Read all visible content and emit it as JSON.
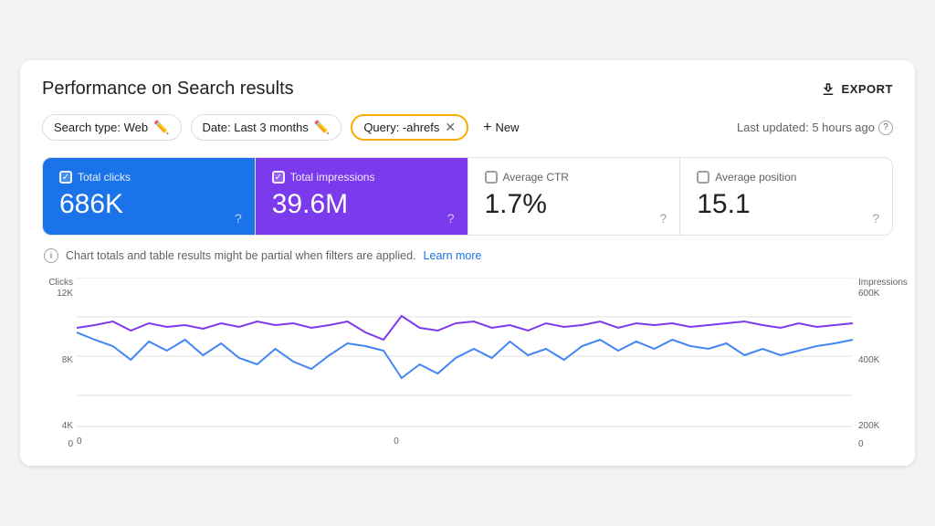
{
  "page": {
    "title": "Performance on Search results",
    "export_label": "EXPORT",
    "last_updated": "Last updated: 5 hours ago"
  },
  "filters": {
    "search_type": "Search type: Web",
    "date": "Date: Last 3 months",
    "query": "Query: -ahrefs",
    "new_label": "New"
  },
  "metrics": [
    {
      "id": "total-clicks",
      "label": "Total clicks",
      "value": "686K",
      "checked": true,
      "color": "blue"
    },
    {
      "id": "total-impressions",
      "label": "Total impressions",
      "value": "39.6M",
      "checked": true,
      "color": "purple"
    },
    {
      "id": "average-ctr",
      "label": "Average CTR",
      "value": "1.7%",
      "checked": false,
      "color": "white"
    },
    {
      "id": "average-position",
      "label": "Average position",
      "value": "15.1",
      "checked": false,
      "color": "white"
    }
  ],
  "info_bar": {
    "text": "Chart totals and table results might be partial when filters are applied.",
    "link_text": "Learn more"
  },
  "chart": {
    "left_axis_title": "Clicks",
    "right_axis_title": "Impressions",
    "left_labels": [
      "12K",
      "8K",
      "4K",
      "0"
    ],
    "right_labels": [
      "600K",
      "400K",
      "200K",
      "0"
    ],
    "colors": {
      "clicks": "#4285f4",
      "impressions": "#7c3aed"
    }
  }
}
